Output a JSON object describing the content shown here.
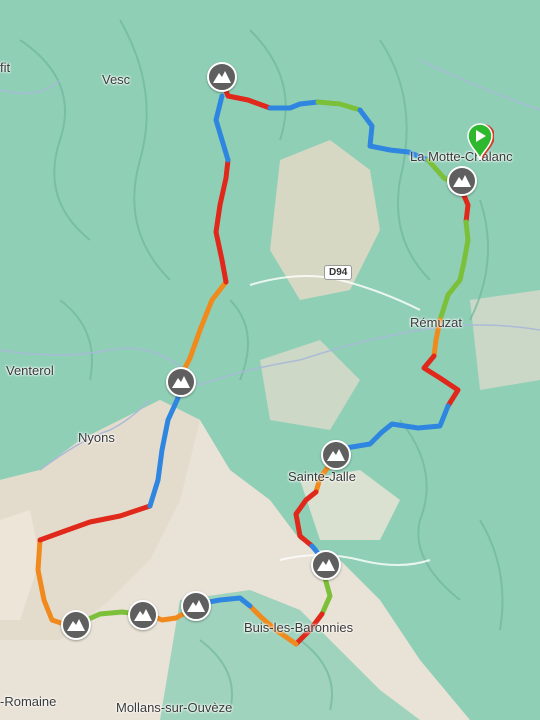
{
  "map": {
    "places": [
      {
        "id": "fit",
        "text": "fit"
      },
      {
        "id": "vesc",
        "text": "Vesc"
      },
      {
        "id": "la-motte-chalancon",
        "text": "La Motte-Chalanc"
      },
      {
        "id": "remuzat",
        "text": "Rémuzat"
      },
      {
        "id": "venterol",
        "text": "Venterol"
      },
      {
        "id": "nyons",
        "text": "Nyons"
      },
      {
        "id": "sainte-jalle",
        "text": "Sainte-Jalle"
      },
      {
        "id": "buis-les-baronnies",
        "text": "Buis-les-Baronnies"
      },
      {
        "id": "romaine",
        "text": "-Romaine"
      },
      {
        "id": "mollans-sur-ouveze",
        "text": "Mollans-sur-Ouvèze"
      }
    ],
    "road_badge": "D94",
    "colors": {
      "terrain_green": "#8fcfb6",
      "terrain_beige": "#e9e2d6",
      "route_blue": "#2f86e0",
      "route_red": "#e0281b",
      "route_orange": "#f08a1c",
      "route_green": "#7cc03a",
      "summit_marker": "#5f5f5f",
      "start_marker": "#2eb82e"
    },
    "summit_icon": "mountain-icon",
    "start_icon": "play-icon"
  }
}
